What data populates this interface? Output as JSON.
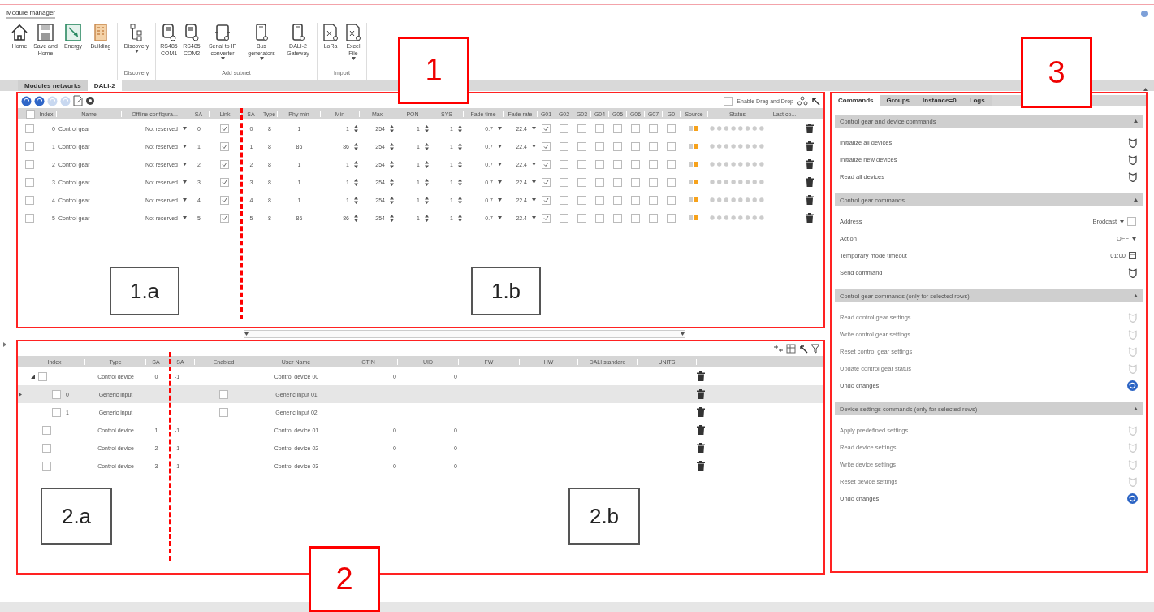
{
  "app_title": "Module manager",
  "ribbon": {
    "groups": [
      {
        "buttons": [
          {
            "label": "Home",
            "dropdown": false
          },
          {
            "label": "Save and Home",
            "dropdown": false
          },
          {
            "label": "Energy",
            "dropdown": false
          },
          {
            "label": "Building",
            "dropdown": false
          }
        ]
      },
      {
        "label": "Discovery",
        "buttons": [
          {
            "label": "Discovery",
            "dropdown": true
          }
        ]
      },
      {
        "label": "Add subnet",
        "buttons": [
          {
            "label": "RS485 COM1",
            "dropdown": false
          },
          {
            "label": "RS485 COM2",
            "dropdown": false
          },
          {
            "label": "Serial to IP converter",
            "dropdown": true
          },
          {
            "label": "Bus generators",
            "dropdown": true
          },
          {
            "label": "DALI-2 Gateway",
            "dropdown": false
          }
        ]
      },
      {
        "label": "Import",
        "buttons": [
          {
            "label": "LoRa",
            "dropdown": false
          },
          {
            "label": "Excel File",
            "dropdown": true
          }
        ]
      }
    ]
  },
  "tabs": [
    {
      "label": "Modules networks",
      "selected": false
    },
    {
      "label": "DALI-2",
      "selected": true
    }
  ],
  "gear_grid": {
    "toolbar": [
      {
        "kind": "round",
        "disabled": false
      },
      {
        "kind": "round",
        "disabled": false
      },
      {
        "kind": "round",
        "disabled": true
      },
      {
        "kind": "round",
        "disabled": true
      },
      {
        "kind": "document",
        "disabled": false
      },
      {
        "kind": "gear",
        "disabled": false
      }
    ],
    "drag_drop": {
      "label": "Enable Drag and Drop",
      "checked": false
    },
    "all_selected": false,
    "columns": [
      "Index",
      "Name",
      "Offline configura...",
      "SA",
      "Link",
      "SA",
      "Type",
      "Phy min",
      "Min",
      "Max",
      "PON",
      "SYS",
      "Fade time",
      "Fade rate",
      "G01",
      "G02",
      "G03",
      "G04",
      "G05",
      "G06",
      "G07",
      "G0",
      "Source",
      "Status",
      "Last co..."
    ],
    "rows": [
      {
        "checked": false,
        "index": "0",
        "name": "Control gear",
        "offline": "Not reserved",
        "sa": "0",
        "link": true,
        "sa_2": "0",
        "type": "8",
        "phy_min": "1",
        "min": "1",
        "max": "254",
        "pon": "1",
        "sys": "1",
        "fade_time": "0.7",
        "fade_rate": "22.4",
        "groups": [
          true,
          false,
          false,
          false,
          false,
          false,
          false,
          false
        ]
      },
      {
        "checked": false,
        "index": "1",
        "name": "Control gear",
        "offline": "Not reserved",
        "sa": "1",
        "link": true,
        "sa_2": "1",
        "type": "8",
        "phy_min": "86",
        "min": "86",
        "max": "254",
        "pon": "1",
        "sys": "1",
        "fade_time": "0.7",
        "fade_rate": "22.4",
        "groups": [
          true,
          false,
          false,
          false,
          false,
          false,
          false,
          false
        ]
      },
      {
        "checked": false,
        "index": "2",
        "name": "Control gear",
        "offline": "Not reserved",
        "sa": "2",
        "link": true,
        "sa_2": "2",
        "type": "8",
        "phy_min": "1",
        "min": "1",
        "max": "254",
        "pon": "1",
        "sys": "1",
        "fade_time": "0.7",
        "fade_rate": "22.4",
        "groups": [
          true,
          false,
          false,
          false,
          false,
          false,
          false,
          false
        ]
      },
      {
        "checked": false,
        "index": "3",
        "name": "Control gear",
        "offline": "Not reserved",
        "sa": "3",
        "link": true,
        "sa_2": "3",
        "type": "8",
        "phy_min": "1",
        "min": "1",
        "max": "254",
        "pon": "1",
        "sys": "1",
        "fade_time": "0.7",
        "fade_rate": "22.4",
        "groups": [
          true,
          false,
          false,
          false,
          false,
          false,
          false,
          false
        ]
      },
      {
        "checked": false,
        "index": "4",
        "name": "Control gear",
        "offline": "Not reserved",
        "sa": "4",
        "link": true,
        "sa_2": "4",
        "type": "8",
        "phy_min": "1",
        "min": "1",
        "max": "254",
        "pon": "1",
        "sys": "1",
        "fade_time": "0.7",
        "fade_rate": "22.4",
        "groups": [
          true,
          false,
          false,
          false,
          false,
          false,
          false,
          false
        ]
      },
      {
        "checked": false,
        "index": "5",
        "name": "Control gear",
        "offline": "Not reserved",
        "sa": "5",
        "link": true,
        "sa_2": "5",
        "type": "8",
        "phy_min": "86",
        "min": "86",
        "max": "254",
        "pon": "1",
        "sys": "1",
        "fade_time": "0.7",
        "fade_rate": "22.4",
        "groups": [
          true,
          false,
          false,
          false,
          false,
          false,
          false,
          false
        ]
      }
    ]
  },
  "device_grid": {
    "columns": [
      "Index",
      "Type",
      "SA",
      "SA",
      "Enabled",
      "User Name",
      "GTIN",
      "UID",
      "FW",
      "HW",
      "DALI standard",
      "UNITS"
    ],
    "rows": [
      {
        "checked": false,
        "expanded": true,
        "selected": false,
        "type": "Control device",
        "sa": "0",
        "sa_2": "-1",
        "user_name": "Control device 00",
        "gtin": "0",
        "uid": "0",
        "children": [
          {
            "checked": false,
            "selected": true,
            "index": "0",
            "type": "Generic input",
            "enabled": false,
            "user_name": "Generic input 01"
          },
          {
            "checked": false,
            "selected": false,
            "index": "1",
            "type": "Generic input",
            "enabled": false,
            "user_name": "Generic input 02"
          }
        ]
      },
      {
        "checked": false,
        "selected": false,
        "type": "Control device",
        "sa": "1",
        "sa_2": "-1",
        "user_name": "Control device 01",
        "gtin": "0",
        "uid": "0"
      },
      {
        "checked": false,
        "selected": false,
        "type": "Control device",
        "sa": "2",
        "sa_2": "-1",
        "user_name": "Control device 02",
        "gtin": "0",
        "uid": "0"
      },
      {
        "checked": false,
        "selected": false,
        "type": "Control device",
        "sa": "3",
        "sa_2": "-1",
        "user_name": "Control device 03",
        "gtin": "0",
        "uid": "0"
      }
    ]
  },
  "side_panel": {
    "tabs": [
      {
        "label": "Commands",
        "selected": true
      },
      {
        "label": "Groups",
        "selected": false
      },
      {
        "label": "Instance=0",
        "selected": false
      },
      {
        "label": "Logs",
        "selected": false
      }
    ],
    "sections": [
      {
        "title": "Control gear and device commands",
        "expanded": true,
        "items": [
          {
            "kind": "action",
            "label": "Initialize all devices",
            "disabled": false
          },
          {
            "kind": "action",
            "label": "Initialize new devices",
            "disabled": false
          },
          {
            "kind": "action",
            "label": "Read all devices",
            "disabled": false
          }
        ]
      },
      {
        "title": "Control gear commands",
        "expanded": true,
        "items": [
          {
            "kind": "select",
            "label": "Address",
            "value": "Brodcast",
            "checked": false
          },
          {
            "kind": "select",
            "label": "Action",
            "value": "OFF"
          },
          {
            "kind": "time",
            "label": "Temporary mode timeout",
            "value": "01:00"
          },
          {
            "kind": "action",
            "label": "Send command",
            "disabled": false
          }
        ]
      },
      {
        "title": "Control gear commands (only for selected rows)",
        "expanded": true,
        "items": [
          {
            "kind": "action",
            "label": "Read control gear settings",
            "disabled": true
          },
          {
            "kind": "action",
            "label": "Write control gear settings",
            "disabled": true
          },
          {
            "kind": "action",
            "label": "Reset control gear settings",
            "disabled": true
          },
          {
            "kind": "action",
            "label": "Update control gear status",
            "disabled": true
          },
          {
            "kind": "undo",
            "label": "Undo changes",
            "disabled": false
          }
        ]
      },
      {
        "title": "Device settings commands (only for selected rows)",
        "expanded": true,
        "items": [
          {
            "kind": "action",
            "label": "Apply predefined settings",
            "disabled": true
          },
          {
            "kind": "action",
            "label": "Read device settings",
            "disabled": true
          },
          {
            "kind": "action",
            "label": "Write device settings",
            "disabled": true
          },
          {
            "kind": "action",
            "label": "Reset device settings",
            "disabled": true
          },
          {
            "kind": "undo",
            "label": "Undo changes",
            "disabled": false
          }
        ]
      }
    ]
  },
  "callouts": [
    {
      "label": "1",
      "kind": "region"
    },
    {
      "label": "1.a",
      "kind": "part"
    },
    {
      "label": "1.b",
      "kind": "part"
    },
    {
      "label": "2",
      "kind": "region"
    },
    {
      "label": "2.a",
      "kind": "part"
    },
    {
      "label": "2.b",
      "kind": "part"
    },
    {
      "label": "3",
      "kind": "region"
    }
  ]
}
